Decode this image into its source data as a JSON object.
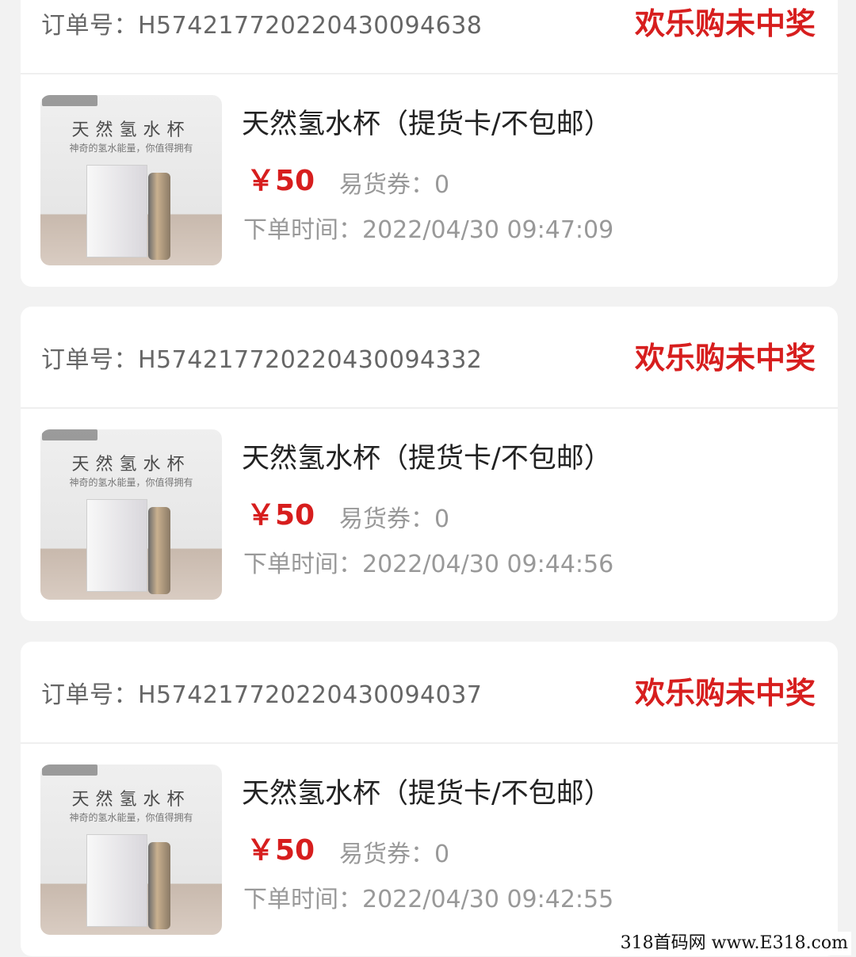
{
  "orders": [
    {
      "order_label": "订单号：",
      "order_no": "H574217720220430094638",
      "status": "欢乐购未中奖",
      "product": {
        "image_title": "天然氢水杯",
        "image_subtitle": "神奇的氢水能量，你值得拥有",
        "name": "天然氢水杯（提货卡/不包邮）",
        "price": "￥50",
        "coupon": "易货券：0",
        "order_time": "下单时间：2022/04/30 09:47:09"
      }
    },
    {
      "order_label": "订单号：",
      "order_no": "H574217720220430094332",
      "status": "欢乐购未中奖",
      "product": {
        "image_title": "天然氢水杯",
        "image_subtitle": "神奇的氢水能量，你值得拥有",
        "name": "天然氢水杯（提货卡/不包邮）",
        "price": "￥50",
        "coupon": "易货券：0",
        "order_time": "下单时间：2022/04/30 09:44:56"
      }
    },
    {
      "order_label": "订单号：",
      "order_no": "H574217720220430094037",
      "status": "欢乐购未中奖",
      "product": {
        "image_title": "天然氢水杯",
        "image_subtitle": "神奇的氢水能量，你值得拥有",
        "name": "天然氢水杯（提货卡/不包邮）",
        "price": "￥50",
        "coupon": "易货券：0",
        "order_time": "下单时间：2022/04/30 09:42:55"
      }
    }
  ],
  "watermark": "318首码网 www.E318.com",
  "colors": {
    "status": "#d71e1e",
    "price": "#d71e1e",
    "muted": "#999999",
    "background": "#f2f2f2"
  }
}
